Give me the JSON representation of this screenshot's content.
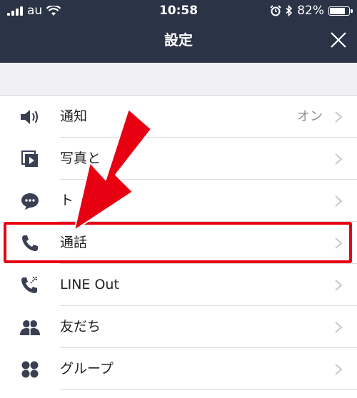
{
  "status_bar": {
    "carrier": "au",
    "time": "10:58",
    "battery": "82%",
    "battery_level": 0.82
  },
  "header": {
    "title": "設定",
    "close_icon": "close-icon"
  },
  "settings": {
    "items": [
      {
        "label": "通知",
        "value": "オン",
        "icon": "speaker-icon"
      },
      {
        "label": "写真と",
        "value": "",
        "icon": "photo-video-icon"
      },
      {
        "label": "ト",
        "value": "",
        "icon": "chat-bubble-icon"
      },
      {
        "label": "通話",
        "value": "",
        "icon": "phone-icon"
      },
      {
        "label": "LINE Out",
        "value": "",
        "icon": "line-out-phone-icon"
      },
      {
        "label": "友だち",
        "value": "",
        "icon": "friends-icon"
      },
      {
        "label": "グループ",
        "value": "",
        "icon": "group-icon"
      }
    ]
  },
  "colors": {
    "header_bg": "#2b3346",
    "highlight": "#e60012",
    "icon": "#3a4052"
  }
}
